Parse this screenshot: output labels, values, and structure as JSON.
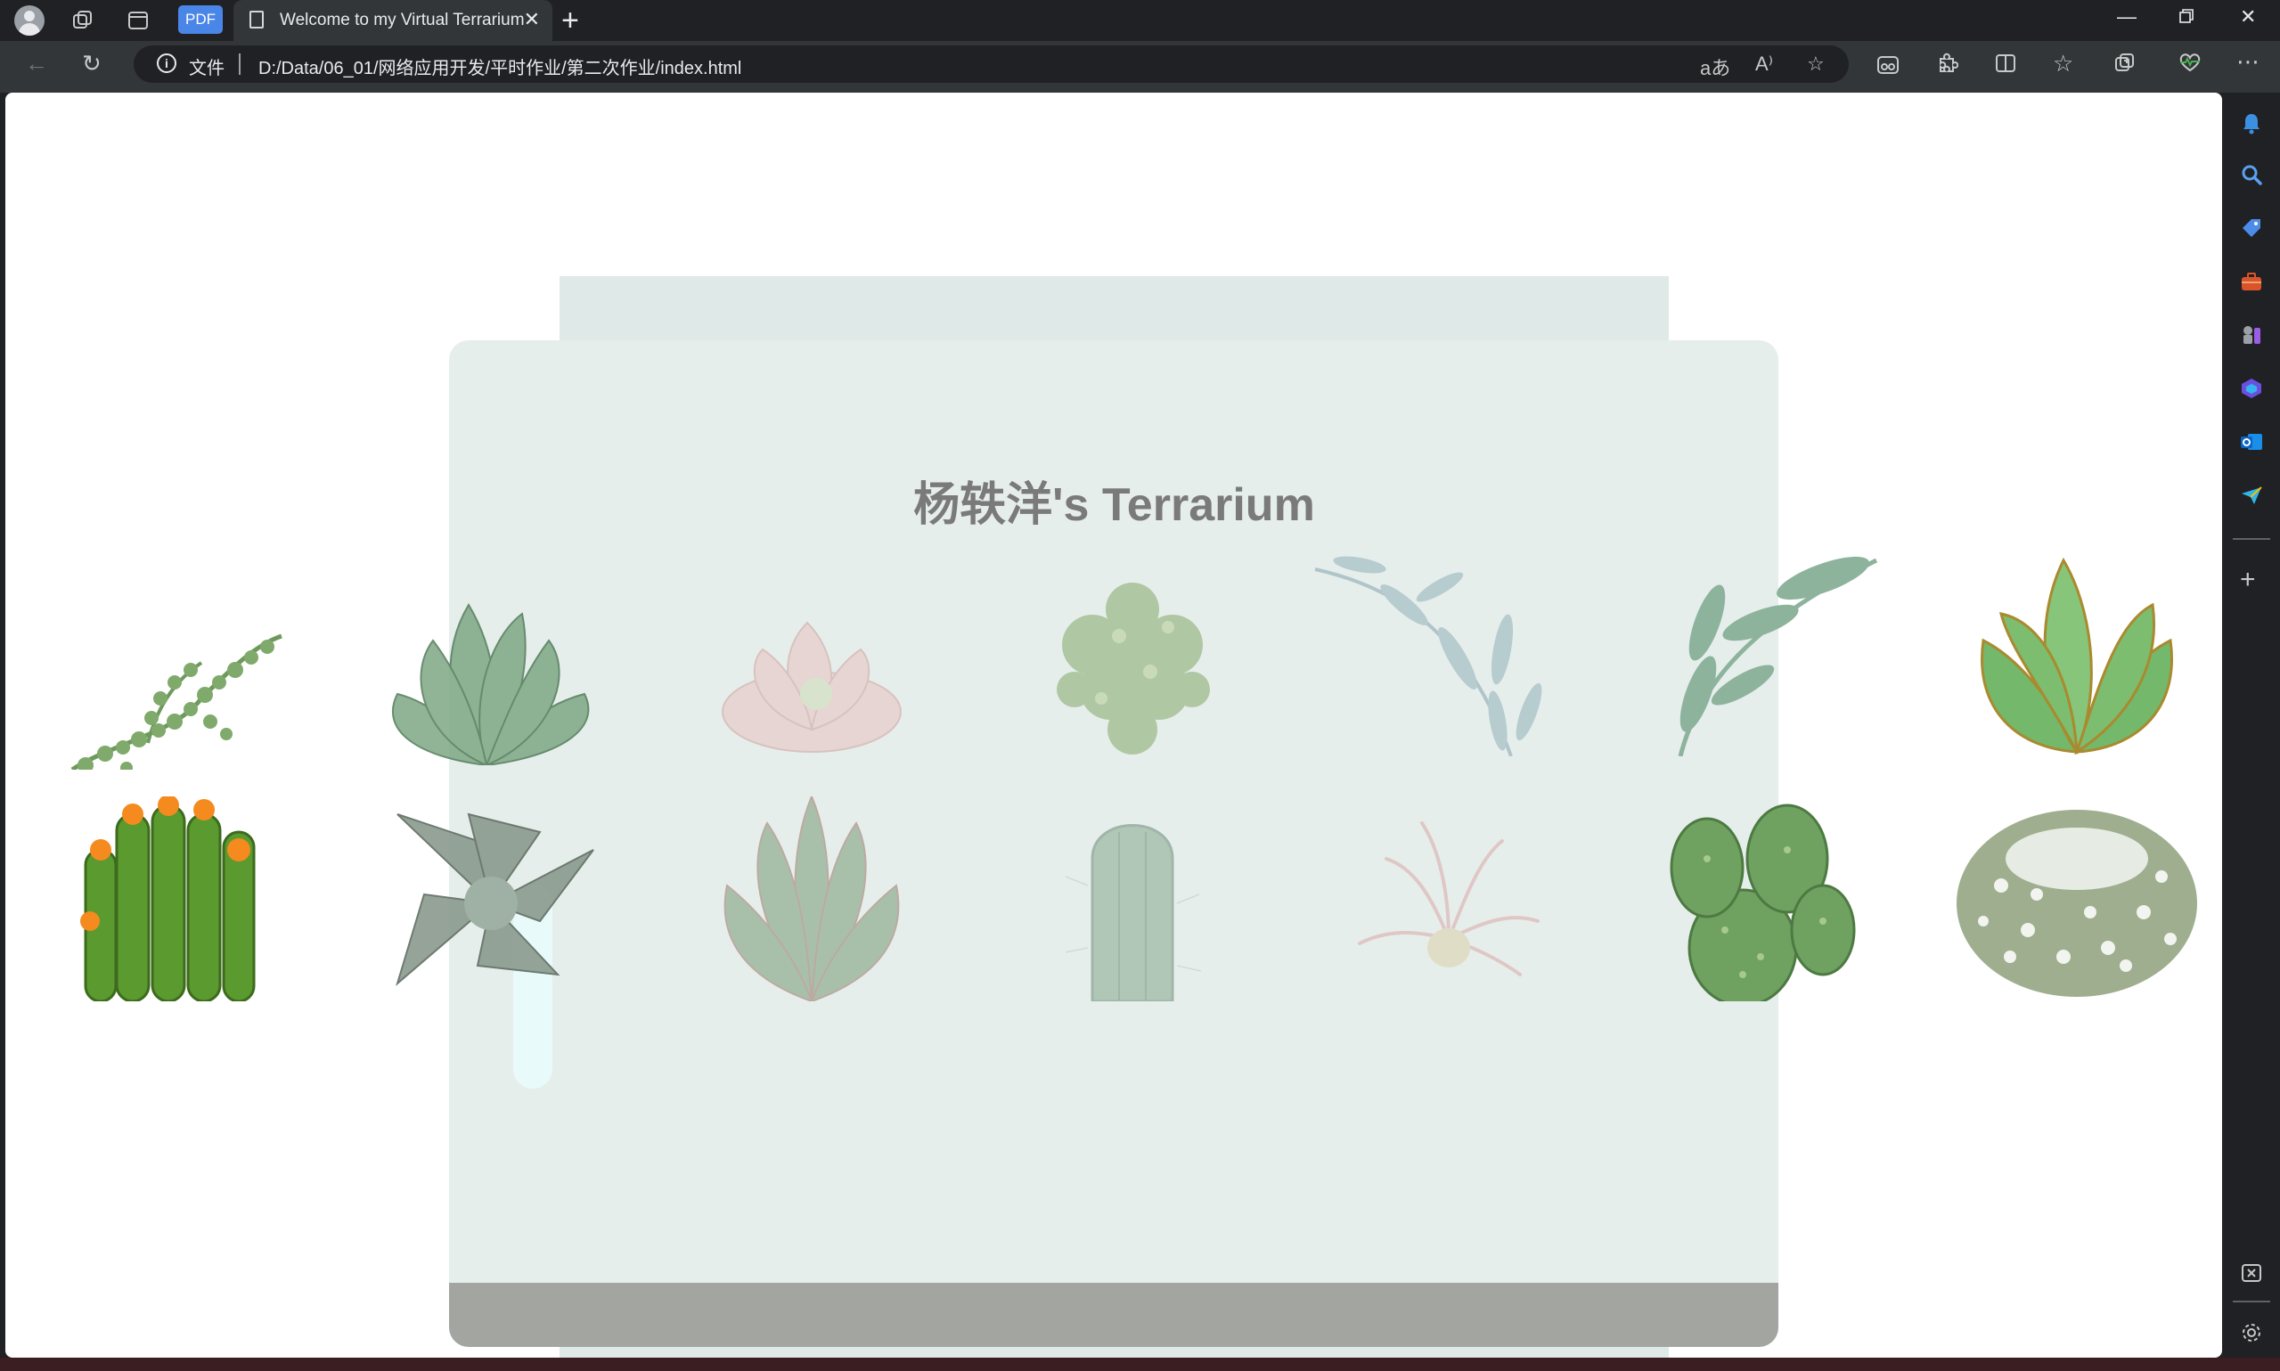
{
  "browser": {
    "tab_title": "Welcome to my Virtual Terrarium",
    "pdf_label": "PDF",
    "address_scheme": "文件",
    "address_url": "D:/Data/06_01/网络应用开发/平时作业/第二次作业/index.html"
  },
  "page": {
    "heading": "杨轶洋's Terrarium"
  },
  "plants": [
    {
      "name": "string-of-pearls",
      "side": "left"
    },
    {
      "name": "echeveria-green",
      "side": "left"
    },
    {
      "name": "echeveria-pink",
      "side": "left"
    },
    {
      "name": "clustered-succulent",
      "side": "left"
    },
    {
      "name": "eucalyptus-sprig",
      "side": "left"
    },
    {
      "name": "leafy-sprig",
      "side": "right"
    },
    {
      "name": "green-rosette",
      "side": "right"
    },
    {
      "name": "flowering-cactus",
      "side": "left"
    },
    {
      "name": "gray-echeveria",
      "side": "left"
    },
    {
      "name": "spiky-aloe",
      "side": "left"
    },
    {
      "name": "column-cactus",
      "side": "left"
    },
    {
      "name": "air-plant",
      "side": "left"
    },
    {
      "name": "prickly-pear",
      "side": "right"
    },
    {
      "name": "fuzzy-ball-cactus",
      "side": "right"
    }
  ]
}
